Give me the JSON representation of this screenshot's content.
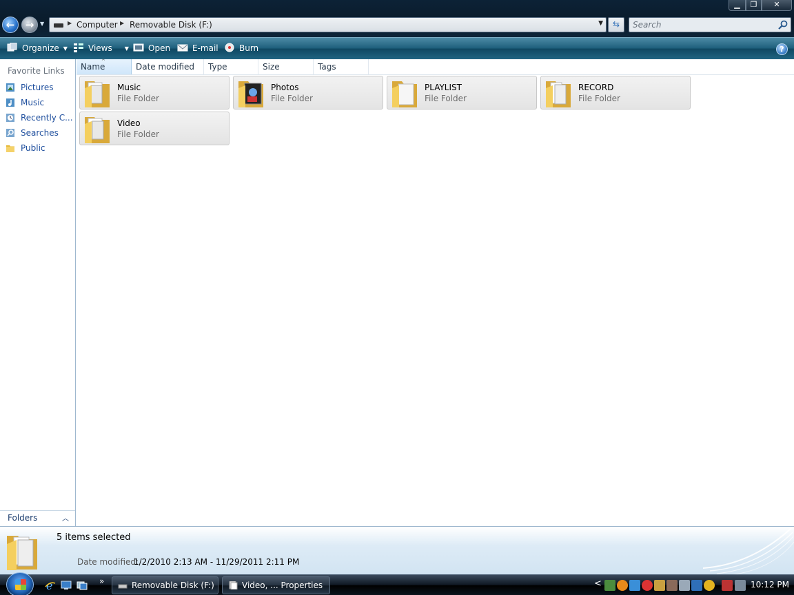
{
  "window": {
    "min_label": "▁",
    "max_label": "❐",
    "close_label": "✕"
  },
  "address": {
    "crumbs": [
      "Computer",
      "Removable Disk (F:)"
    ],
    "separator": "▶"
  },
  "search": {
    "placeholder": "Search"
  },
  "toolbar": {
    "organize": "Organize",
    "views": "Views",
    "open": "Open",
    "email": "E-mail",
    "burn": "Burn",
    "help": "?"
  },
  "nav": {
    "title": "Favorite Links",
    "items": [
      {
        "label": "Pictures",
        "icon": "pictures-icon"
      },
      {
        "label": "Music",
        "icon": "music-icon"
      },
      {
        "label": "Recently C...",
        "icon": "recent-icon"
      },
      {
        "label": "Searches",
        "icon": "searches-icon"
      },
      {
        "label": "Public",
        "icon": "public-folder-icon"
      }
    ],
    "folders_label": "Folders"
  },
  "columns": [
    "Name",
    "Date modified",
    "Type",
    "Size",
    "Tags"
  ],
  "items": [
    {
      "name": "Music",
      "type": "File Folder"
    },
    {
      "name": "Photos",
      "type": "File Folder"
    },
    {
      "name": "PLAYLIST",
      "type": "File Folder"
    },
    {
      "name": "RECORD",
      "type": "File Folder"
    },
    {
      "name": "Video",
      "type": "File Folder"
    }
  ],
  "details": {
    "count": "5 items selected",
    "date_modified_label": "Date modified:",
    "date_modified_value": "1/2/2010 2:13 AM - 11/29/2011 2:11 PM"
  },
  "taskbar": {
    "tasks": [
      "Removable Disk (F:)",
      "Video, ... Properties"
    ],
    "clock": "10:12 PM",
    "more": "»"
  },
  "colors": {
    "cmdbar": "#1e5f7c",
    "selection_tile": "#e4e4e4",
    "link": "#1e4e9d"
  }
}
